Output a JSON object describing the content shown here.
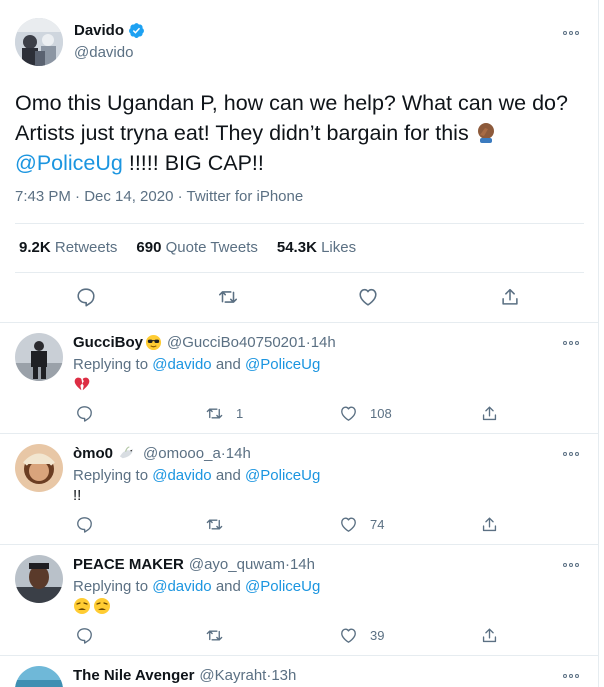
{
  "tweet": {
    "author_name": "Davido",
    "author_handle": "@davido",
    "text_part1": "Omo this Ugandan P, how can we help? What can we do? Artists just tryna eat! They didn’t bargain for this ",
    "mention": "@PoliceUg",
    "text_part2": " !!!!! BIG CAP!!",
    "meta": "7:43 PM · Dec 14, 2020 · Twitter for iPhone",
    "retweets_count": "9.2K",
    "retweets_label": "Retweets",
    "quotes_count": "690",
    "quotes_label": "Quote Tweets",
    "likes_count": "54.3K",
    "likes_label": "Likes"
  },
  "replies": [
    {
      "name": "GucciBoy",
      "handle": "@GucciBo40750201",
      "time": "14h",
      "replying_prefix": "Replying to ",
      "replying_to_1": "@davido",
      "replying_and": " and ",
      "replying_to_2": "@PoliceUg",
      "content": "",
      "content_emoji": "broken-heart",
      "retweets": "1",
      "likes": "108",
      "name_emoji": "sunglasses-face"
    },
    {
      "name": "òmo0",
      "handle": "@omooo_a",
      "time": "14h",
      "replying_prefix": "Replying to ",
      "replying_to_1": "@davido",
      "replying_and": " and ",
      "replying_to_2": "@PoliceUg",
      "content": "!!",
      "retweets": "",
      "likes": "74",
      "name_emoji": "dove"
    },
    {
      "name": "PEACE MAKER",
      "handle": "@ayo_quwam",
      "time": "14h",
      "replying_prefix": "Replying to ",
      "replying_to_1": "@davido",
      "replying_and": " and ",
      "replying_to_2": "@PoliceUg",
      "content": "",
      "content_emoji": "weary-faces",
      "retweets": "",
      "likes": "39"
    },
    {
      "name": "The Nile Avenger",
      "handle": "@Kayraht",
      "time": "13h"
    }
  ],
  "separator": " · ",
  "colors": {
    "link": "#1b95e0",
    "secondary": "#5b7083",
    "verified": "#1da1f2",
    "border": "#e6ecf0"
  }
}
